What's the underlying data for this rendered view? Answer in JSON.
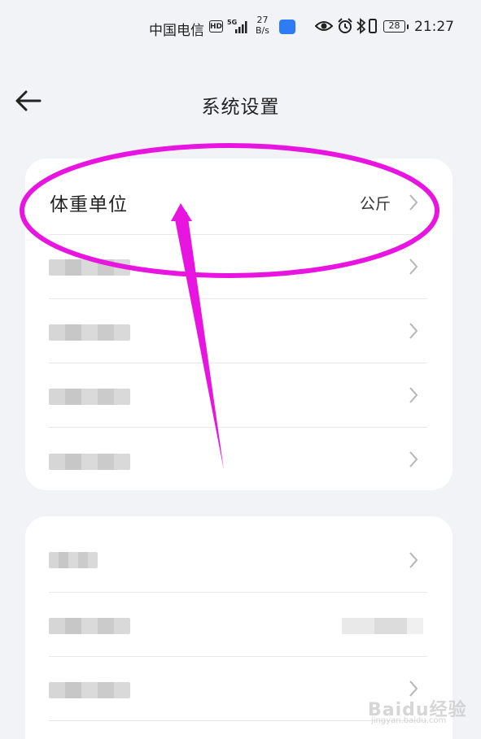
{
  "status_bar": {
    "carrier": "中国电信",
    "hd": "HD",
    "network": "5G",
    "speed_value": "27",
    "speed_unit": "B/s",
    "battery": "28",
    "time": "21:27"
  },
  "header": {
    "title": "系统设置"
  },
  "settings_group_1": [
    {
      "label": "体重单位",
      "value": "公斤"
    },
    {
      "label": "",
      "value": ""
    },
    {
      "label": "",
      "value": ""
    },
    {
      "label": "",
      "value": ""
    },
    {
      "label": "",
      "value": ""
    }
  ],
  "settings_group_2": [
    {
      "label": "",
      "value": ""
    },
    {
      "label": "",
      "value": ""
    },
    {
      "label": "",
      "value": ""
    }
  ],
  "watermark": {
    "brand": "Baidu经验",
    "url": "jingyan.baidu.com"
  },
  "colors": {
    "background": "#f2f3f6",
    "card": "#ffffff",
    "annotation": "#e815e0"
  },
  "icons": [
    "back-arrow-icon",
    "chevron-right-icon",
    "eye-icon",
    "alarm-icon",
    "bluetooth-icon",
    "vibrate-icon",
    "battery-icon",
    "signal-icon"
  ]
}
